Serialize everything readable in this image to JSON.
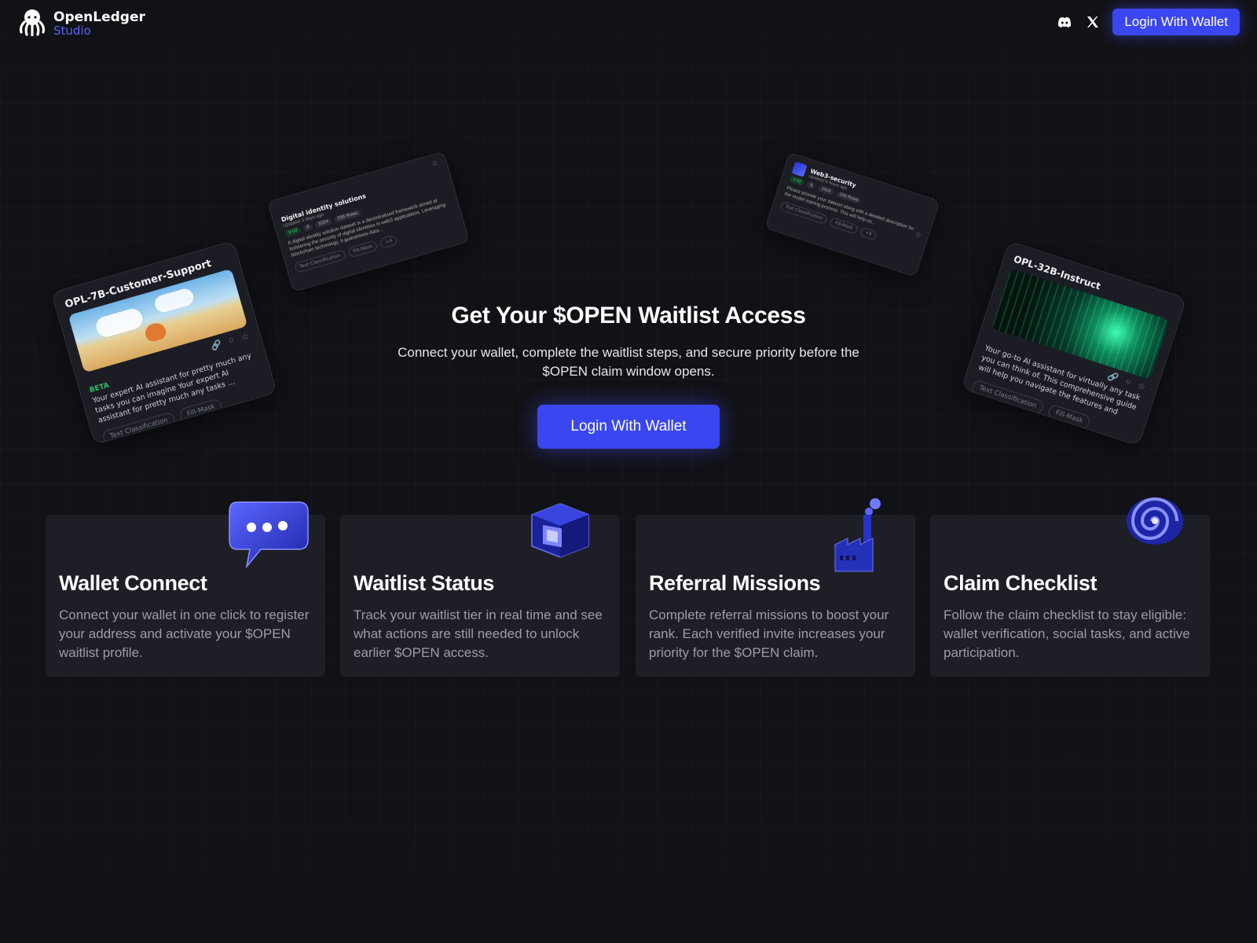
{
  "header": {
    "brand_line1": "OpenLedger",
    "brand_line2": "Studio",
    "login_label": "Login With Wallet",
    "icons": [
      "octopus-logo-icon",
      "discord-icon",
      "x-twitter-icon"
    ]
  },
  "hero": {
    "title": "Get Your $OPEN Waitlist Access",
    "subtitle": "Connect your wallet, complete the waitlist steps, and secure priority before the $OPEN claim window opens.",
    "cta_label": "Login With Wallet"
  },
  "floating_cards": {
    "card1": {
      "title": "OPL-7B-Customer-Support",
      "badge": "BETA",
      "description": "Your expert AI assistant for  pretty much any tasks you can imagine Your expert AI assistant for  pretty much any tasks ...",
      "tags": [
        "Text Classification",
        "Fill-Mask"
      ]
    },
    "card2": {
      "title": "Digital identity solutions",
      "updated": "Updated 3 days ago",
      "version": "V-02",
      "stat_likes": "8",
      "stat_views": "1024",
      "stat_rows": "256 Rows",
      "description": "A digital identity solution dataset is a decentralized framework aimed at bolstering the security of digital identities in web3 applications. Leveraging blockchain technology, it guarantees data...",
      "tags": [
        "Text Classification",
        "Fill-Mask",
        "+4"
      ]
    },
    "card3": {
      "title": "Web3-security",
      "updated": "Updated 6 hours ago",
      "version": "V-02",
      "stat_likes": "8",
      "stat_views": "1024",
      "stat_rows": "256 Rows",
      "description": "Please provide your dataset along with a detailed description for the model training process. This will help us...",
      "tags": [
        "Text Classification",
        "Fill-Mask",
        "+4"
      ]
    },
    "card4": {
      "title": "OPL-32B-Instruct",
      "description": "Your go-to AI assistant for virtually any task you can think of. This comprehensive guide will help you navigate the features and cap...",
      "tags": [
        "Text Classification",
        "Fill-Mask"
      ]
    }
  },
  "features": [
    {
      "title": "Wallet Connect",
      "text": "Connect your wallet in one click to register your address and activate your $OPEN waitlist profile.",
      "icon": "chat-bubble-icon"
    },
    {
      "title": "Waitlist Status",
      "text": "Track your waitlist tier in real time and see what actions are still needed to unlock earlier $OPEN access.",
      "icon": "chip-cube-icon"
    },
    {
      "title": "Referral Missions",
      "text": "Complete referral missions to boost your rank. Each verified invite increases your priority for the $OPEN claim.",
      "icon": "factory-icon"
    },
    {
      "title": "Claim Checklist",
      "text": "Follow the claim checklist to stay eligible: wallet verification, social tasks, and active participation.",
      "icon": "spiral-icon"
    }
  ],
  "colors": {
    "accent": "#3a46f0",
    "background": "#111216",
    "card": "#1e1f26",
    "brand_blue": "#5b63ff",
    "beta_green": "#2fbf6a"
  }
}
